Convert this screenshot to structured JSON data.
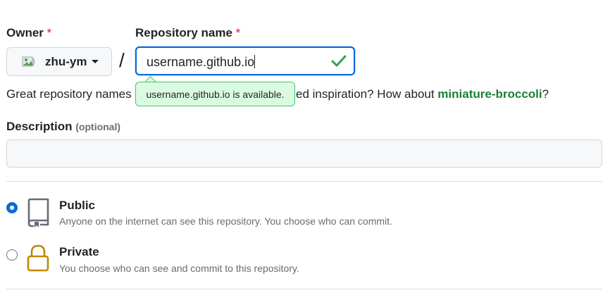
{
  "owner": {
    "label": "Owner",
    "required_mark": "*",
    "selected": "zhu-ym"
  },
  "repository": {
    "label": "Repository name",
    "required_mark": "*",
    "value": "username.github.io",
    "availability_tooltip": "username.github.io is available."
  },
  "separator": "/",
  "hint": {
    "prefix": "Great repository names",
    "middle": "ed inspiration? How about ",
    "suggestion": "miniature-broccoli",
    "suffix": "?"
  },
  "description": {
    "label": "Description",
    "optional_label": "(optional)",
    "value": ""
  },
  "visibility": {
    "options": [
      {
        "title": "Public",
        "description": "Anyone on the internet can see this repository. You choose who can commit.",
        "selected": true,
        "icon": "repo-icon"
      },
      {
        "title": "Private",
        "description": "You choose who can see and commit to this repository.",
        "selected": false,
        "icon": "lock-icon"
      }
    ]
  },
  "colors": {
    "accent": "#0969da",
    "success": "#1a7f37",
    "required": "#cf222e",
    "private_lock": "#bf8700"
  }
}
